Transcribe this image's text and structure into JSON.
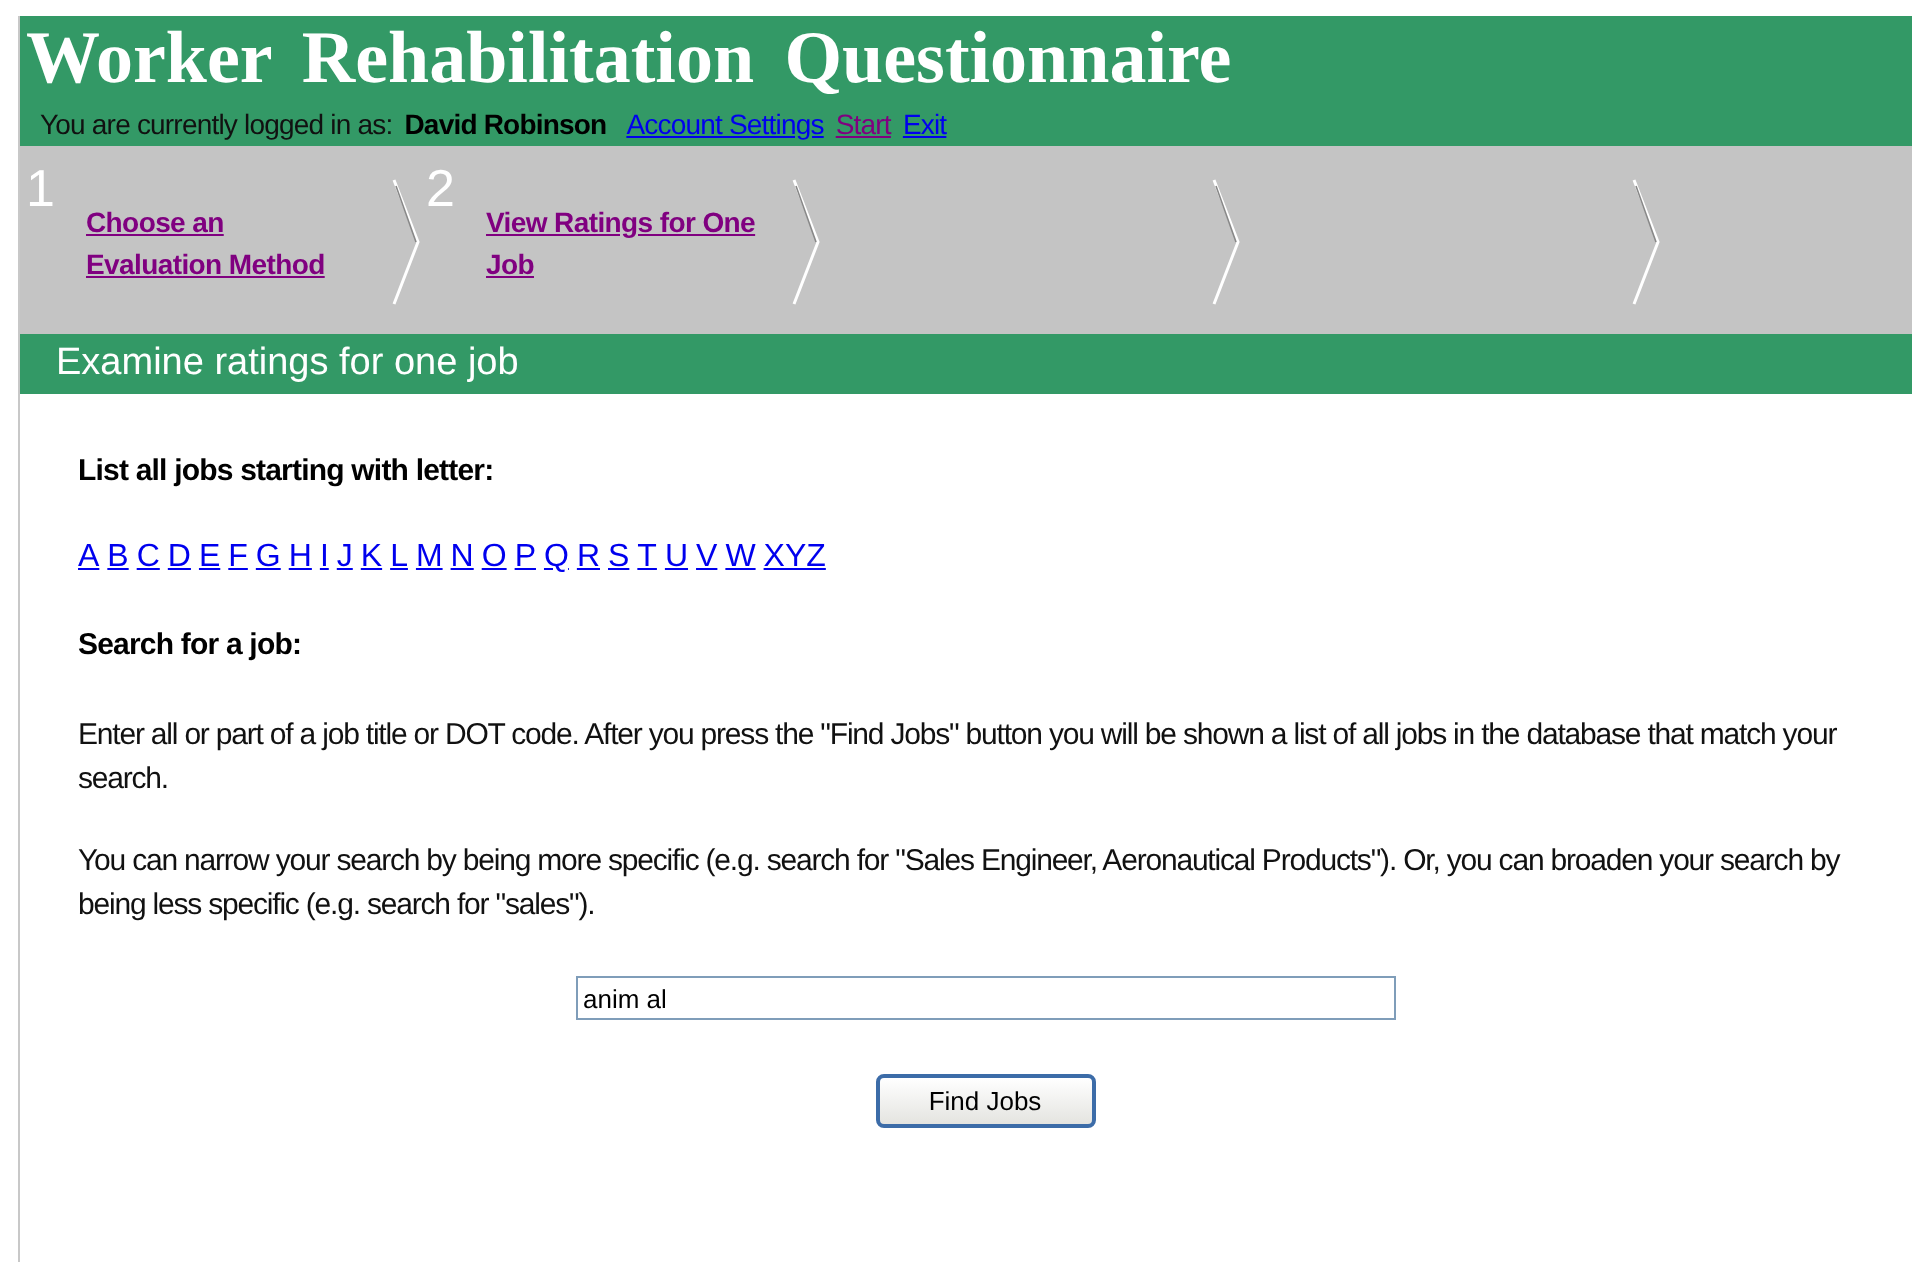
{
  "header": {
    "title": "Worker Rehabilitation Questionnaire",
    "login_label": "You are currently logged in as:",
    "user": "David Robinson",
    "links": [
      {
        "label": "Account Settings",
        "visited": false
      },
      {
        "label": "Start",
        "visited": true
      },
      {
        "label": "Exit",
        "visited": false
      }
    ]
  },
  "steps": [
    {
      "number": "1",
      "label": "Choose an Evaluation Method"
    },
    {
      "number": "2",
      "label": "View Ratings for One Job"
    }
  ],
  "section_title": "Examine ratings for one job",
  "letter_heading": "List all jobs starting with letter:",
  "letters": [
    "A",
    "B",
    "C",
    "D",
    "E",
    "F",
    "G",
    "H",
    "I",
    "J",
    "K",
    "L",
    "M",
    "N",
    "O",
    "P",
    "Q",
    "R",
    "S",
    "T",
    "U",
    "V",
    "W",
    "XYZ"
  ],
  "search_heading": "Search for a job:",
  "paragraphs": [
    "Enter all or part of a job title or DOT code. After you press the \"Find Jobs\" button you will be shown a list of all jobs in the database that match your search.",
    "You can narrow your search by being more specific (e.g. search for \"Sales Engineer, Aeronautical Products\"). Or, you can broaden your search by being less specific (e.g. search for \"sales\")."
  ],
  "search_field": {
    "value": "anim al"
  },
  "button": "Find Jobs"
}
